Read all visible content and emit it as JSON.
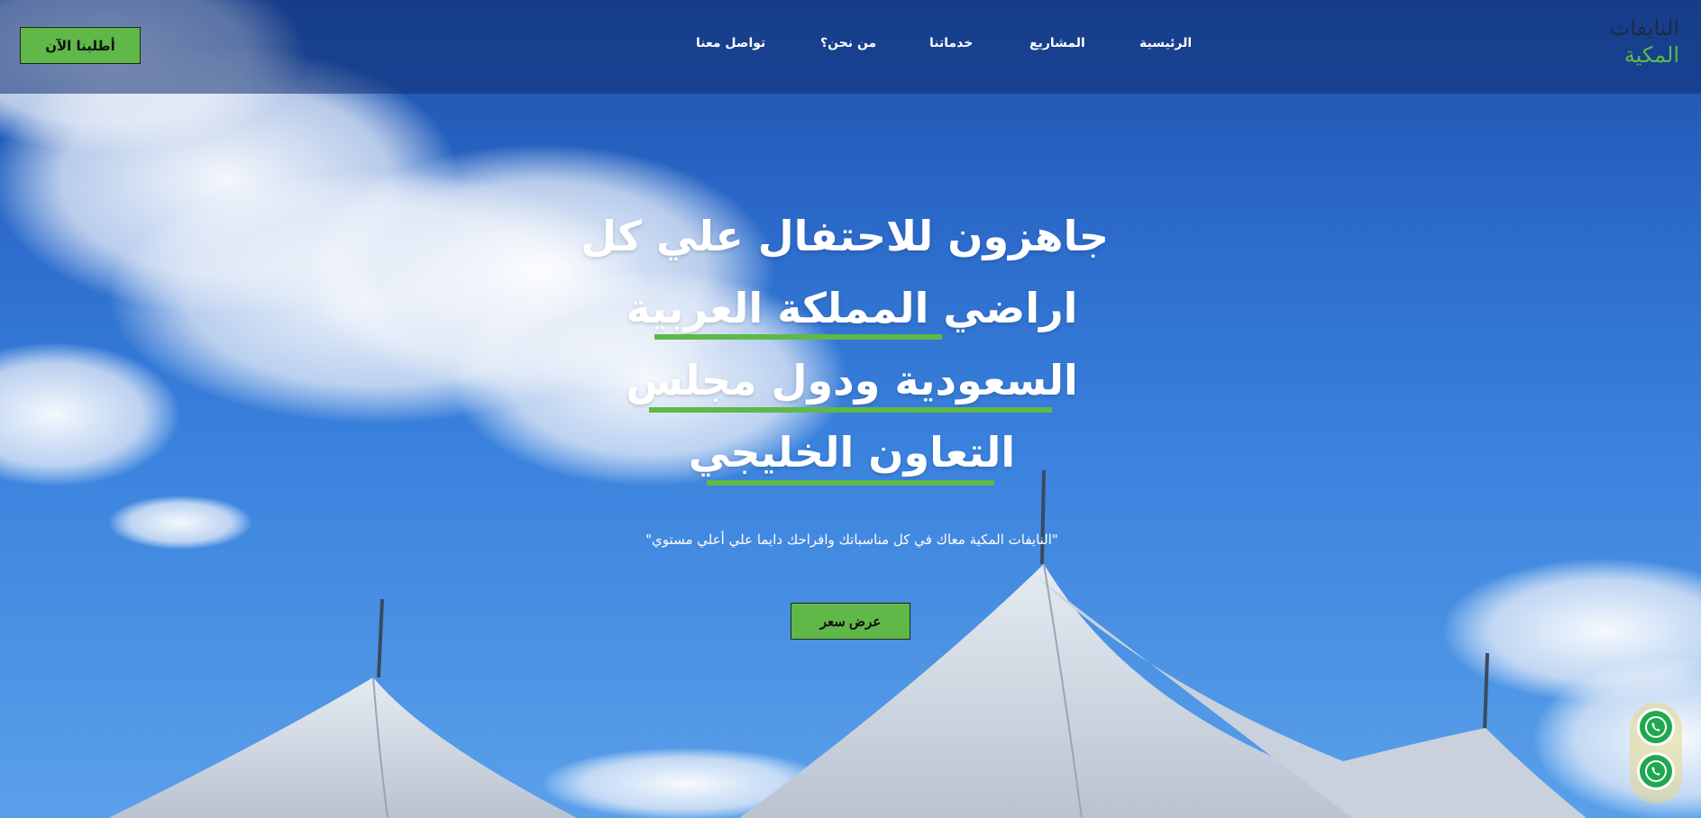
{
  "header": {
    "cta_label": "أطلبنا الآن",
    "logo_line1": "النايفات",
    "logo_line2": "المكية",
    "nav": [
      {
        "label": "الرئيسية"
      },
      {
        "label": "المشاريع"
      },
      {
        "label": "خدماتنا"
      },
      {
        "label": "من نحن؟"
      },
      {
        "label": "تواصل معنا"
      }
    ]
  },
  "hero": {
    "headline_lines": [
      "جاهزون للاحتفال علي كل",
      "اراضي المملكة العربية",
      "السعودية ودول مجلس",
      "التعاون الخليجي"
    ],
    "tagline": "\"النايفات المكية معاك في كل مناسباتك وافراحك دايما علي أعلي مستوي\"",
    "cta_label": "عرض سعر"
  },
  "floating": {
    "icons": [
      "whatsapp-icon",
      "whatsapp-icon"
    ]
  },
  "colors": {
    "accent_green": "#5fb848",
    "nav_overlay": "#103073",
    "logo_dark": "#1f2a44"
  }
}
